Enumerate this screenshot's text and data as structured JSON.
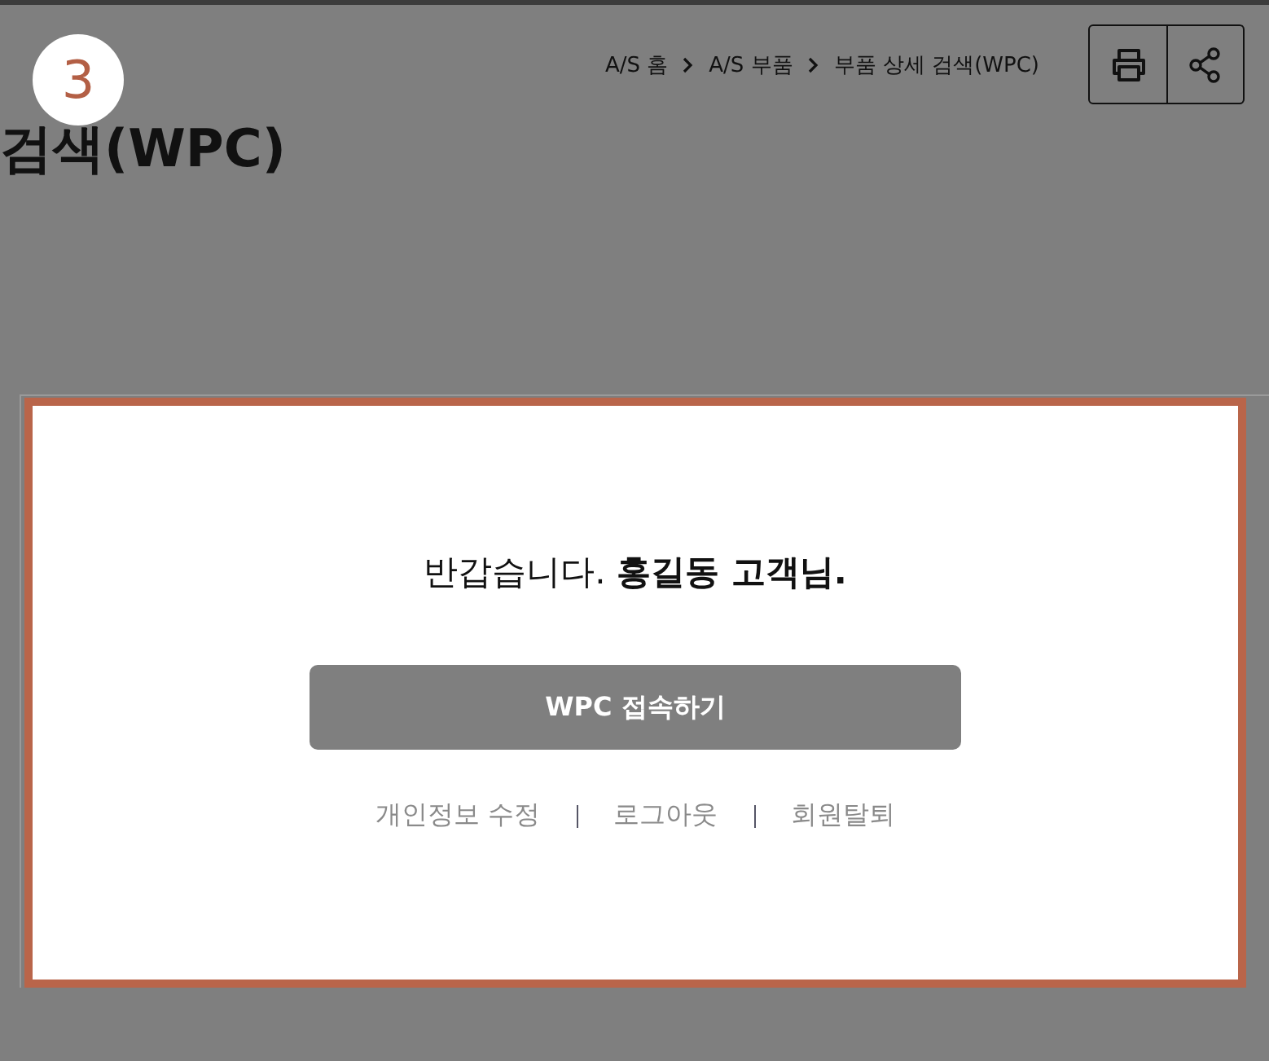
{
  "step_badge": "3",
  "breadcrumb": [
    "A/S 홈",
    "A/S 부품",
    "부품 상세 검색(WPC)"
  ],
  "toolbar": [
    {
      "kind": "print"
    },
    {
      "kind": "share"
    }
  ],
  "page_title": "검색(WPC)",
  "greeting": "반갑습니다. **홍길동 고객님.**",
  "connect_button": "WPC 접속하기",
  "links": [
    "개인정보 수정",
    "로그아웃",
    "회원탈퇴"
  ]
}
